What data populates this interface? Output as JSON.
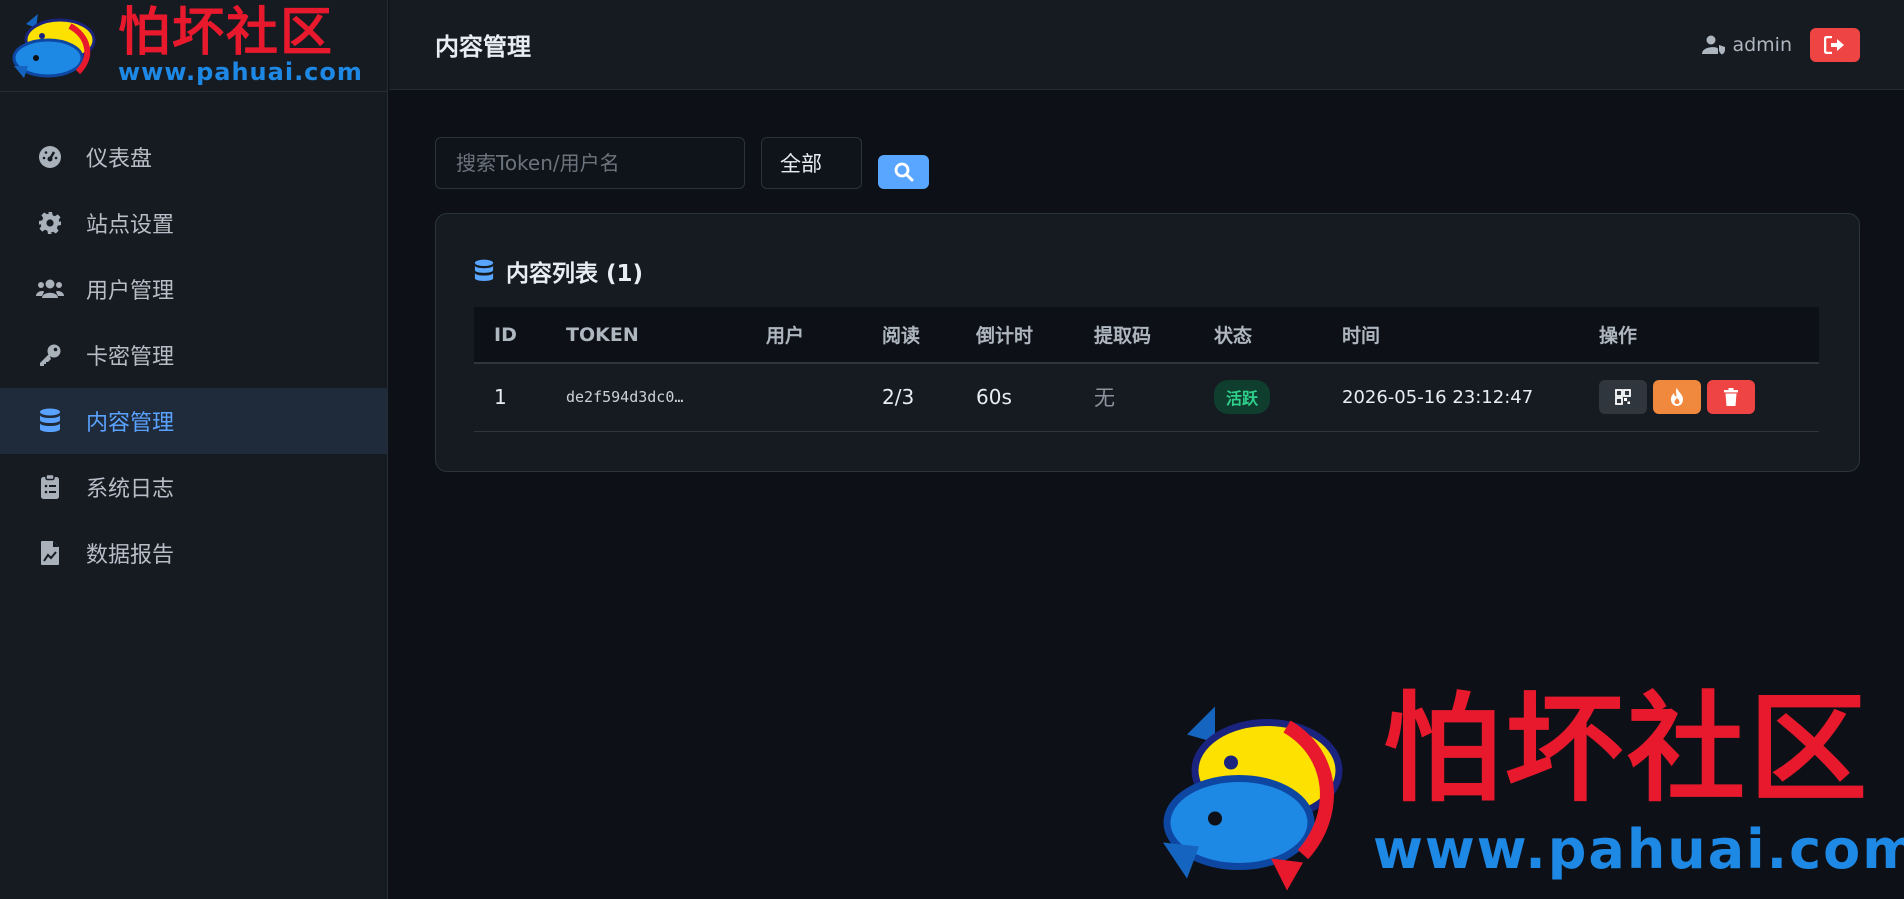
{
  "brand": {
    "title": "怕坏社区",
    "url": "www.pahuai.com"
  },
  "sidebar": {
    "items": [
      {
        "label": "仪表盘",
        "icon": "dashboard-gauge-icon"
      },
      {
        "label": "站点设置",
        "icon": "gear-icon"
      },
      {
        "label": "用户管理",
        "icon": "users-icon"
      },
      {
        "label": "卡密管理",
        "icon": "key-icon"
      },
      {
        "label": "内容管理",
        "icon": "database-icon",
        "active": true
      },
      {
        "label": "系统日志",
        "icon": "clipboard-icon"
      },
      {
        "label": "数据报告",
        "icon": "file-chart-icon"
      }
    ]
  },
  "header": {
    "title": "内容管理",
    "username": "admin"
  },
  "filters": {
    "search_placeholder": "搜索Token/用户名",
    "status_selected": "全部"
  },
  "card": {
    "title": "内容列表 (1)"
  },
  "table": {
    "columns": [
      "ID",
      "TOKEN",
      "用户",
      "阅读",
      "倒计时",
      "提取码",
      "状态",
      "时间",
      "操作"
    ],
    "rows": [
      {
        "id": "1",
        "token": "de2f594d3dc0…",
        "user": "",
        "reads": "2/3",
        "countdown": "60s",
        "code": "无",
        "status": "活跃",
        "time": "2026-05-16 23:12:47"
      }
    ]
  },
  "watermark": {
    "title": "怕坏社区",
    "url": "www.pahuai.com"
  },
  "colors": {
    "accent": "#58a6ff",
    "danger": "#ef4444",
    "warning": "#f0883e",
    "success": "#2fd08c",
    "brand_red": "#e8192c",
    "brand_blue": "#1e88e5"
  }
}
